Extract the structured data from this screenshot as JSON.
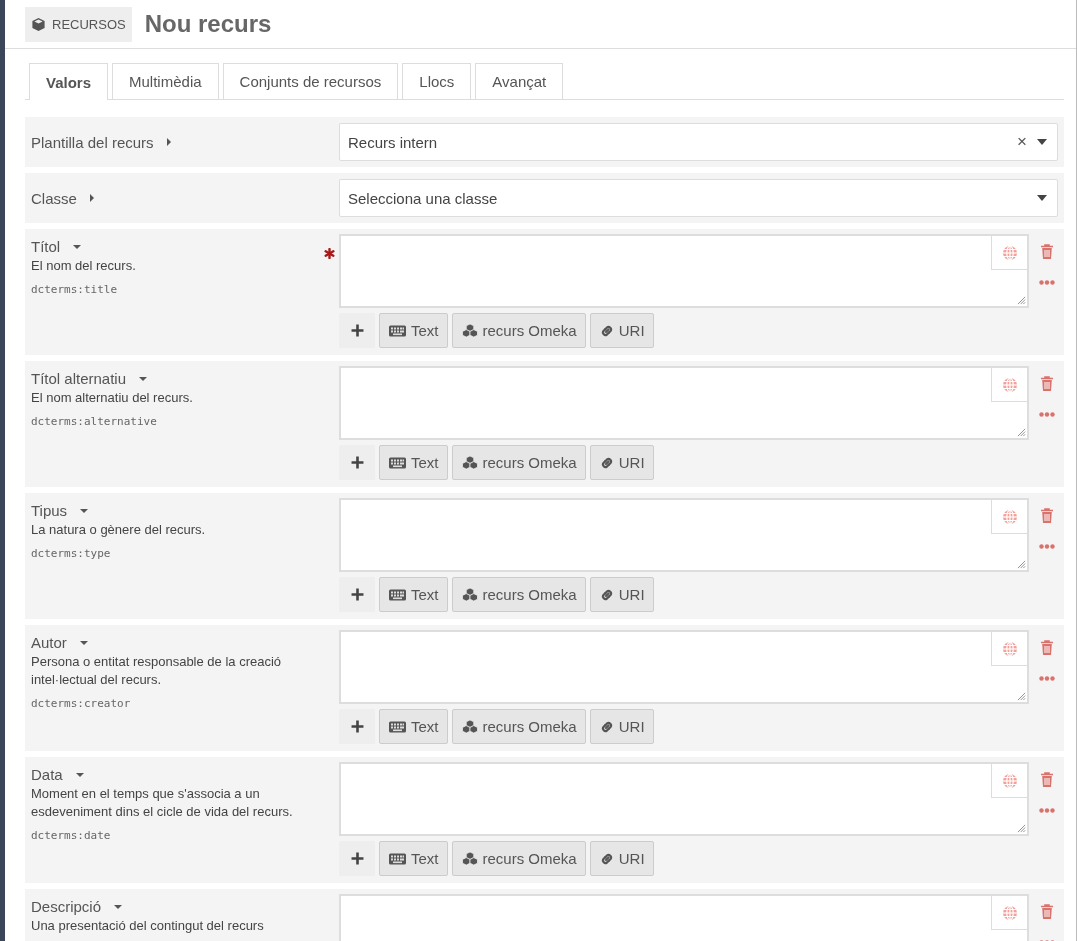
{
  "header": {
    "badge": "RECURSOS",
    "title": "Nou recurs"
  },
  "tabs": [
    {
      "label": "Valors",
      "selected": true
    },
    {
      "label": "Multimèdia",
      "selected": false
    },
    {
      "label": "Conjunts de recursos",
      "selected": false
    },
    {
      "label": "Llocs",
      "selected": false
    },
    {
      "label": "Avançat",
      "selected": false
    }
  ],
  "selects": [
    {
      "label": "Plantilla del recurs",
      "expanded": false,
      "value": "Recurs intern",
      "clear": "×"
    },
    {
      "label": "Classe",
      "expanded": false,
      "placeholder": "Selecciona una classe"
    }
  ],
  "properties": [
    {
      "label": "Títol",
      "expanded": true,
      "required": true,
      "description": "El nom del recurs.",
      "term": "dcterms:title",
      "buttons": [
        {
          "kind": "add"
        },
        {
          "kind": "text",
          "label": "Text"
        },
        {
          "kind": "resource",
          "label": "recurs Omeka"
        },
        {
          "kind": "uri",
          "label": "URI"
        }
      ]
    },
    {
      "label": "Títol alternatiu",
      "expanded": true,
      "required": false,
      "description": "El nom alternatiu del recurs.",
      "term": "dcterms:alternative",
      "buttons": [
        {
          "kind": "add"
        },
        {
          "kind": "text",
          "label": "Text"
        },
        {
          "kind": "resource",
          "label": "recurs Omeka"
        },
        {
          "kind": "uri",
          "label": "URI"
        }
      ]
    },
    {
      "label": "Tipus",
      "expanded": true,
      "required": false,
      "description": "La natura o gènere del recurs.",
      "term": "dcterms:type",
      "buttons": [
        {
          "kind": "add"
        },
        {
          "kind": "text",
          "label": "Text"
        },
        {
          "kind": "resource",
          "label": "recurs Omeka"
        },
        {
          "kind": "uri",
          "label": "URI"
        }
      ]
    },
    {
      "label": "Autor",
      "expanded": true,
      "required": false,
      "description": "Persona o entitat responsable de la creació intel·lectual del recurs.",
      "term": "dcterms:creator",
      "buttons": [
        {
          "kind": "add"
        },
        {
          "kind": "text",
          "label": "Text"
        },
        {
          "kind": "resource",
          "label": "recurs Omeka"
        },
        {
          "kind": "uri",
          "label": "URI"
        }
      ]
    },
    {
      "label": "Data",
      "expanded": true,
      "required": false,
      "description": "Moment en el temps que s'associa a un esdeveniment dins el cicle de vida del recurs.",
      "term": "dcterms:date",
      "buttons": [
        {
          "kind": "add"
        },
        {
          "kind": "text",
          "label": "Text"
        },
        {
          "kind": "resource",
          "label": "recurs Omeka"
        },
        {
          "kind": "uri",
          "label": "URI"
        }
      ]
    },
    {
      "label": "Descripció",
      "expanded": true,
      "required": false,
      "description": "Una presentació del contingut del recurs"
    }
  ]
}
